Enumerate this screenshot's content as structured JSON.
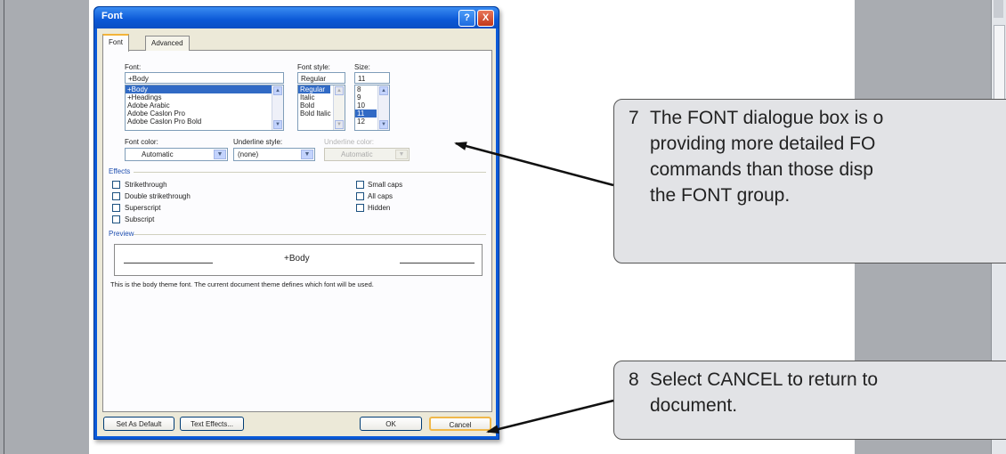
{
  "dialog": {
    "title": "Font",
    "help_icon": "?",
    "close_icon": "X",
    "tabs": [
      {
        "label": "Font"
      },
      {
        "label": "Advanced"
      }
    ],
    "font": {
      "label": "Font:",
      "value": "+Body",
      "items": [
        "+Body",
        "+Headings",
        "Adobe Arabic",
        "Adobe Caslon Pro",
        "Adobe Caslon Pro Bold"
      ],
      "selected": "+Body"
    },
    "font_style": {
      "label": "Font style:",
      "value": "Regular",
      "items": [
        "Regular",
        "Italic",
        "Bold",
        "Bold Italic"
      ],
      "selected": "Regular"
    },
    "size": {
      "label": "Size:",
      "value": "11",
      "items": [
        "8",
        "9",
        "10",
        "11",
        "12"
      ],
      "selected": "11"
    },
    "font_color": {
      "label": "Font color:",
      "value": "Automatic"
    },
    "underline_style": {
      "label": "Underline style:",
      "value": "(none)"
    },
    "underline_color": {
      "label": "Underline color:",
      "value": "Automatic"
    },
    "effects": {
      "title": "Effects",
      "left": [
        "Strikethrough",
        "Double strikethrough",
        "Superscript",
        "Subscript"
      ],
      "right": [
        "Small caps",
        "All caps",
        "Hidden"
      ]
    },
    "preview": {
      "title": "Preview",
      "text": "+Body",
      "description": "This is the body theme font. The current document theme defines which font will be used."
    },
    "buttons": {
      "set_default": "Set As Default",
      "text_effects": "Text Effects...",
      "ok": "OK",
      "cancel": "Cancel"
    }
  },
  "callouts": [
    {
      "number": "7",
      "first_line": "The FONT dialogue box is o",
      "lines": [
        "providing more detailed FO",
        "commands than those disp",
        "the FONT group."
      ]
    },
    {
      "number": "8",
      "first_line": "Select CANCEL to return to",
      "lines": [
        "document."
      ]
    }
  ],
  "colors": {
    "titlebar": "#0b58d6",
    "dialog_face": "#ece9d8",
    "selection": "#316ac5",
    "callout_bg": "#e2e3e6"
  }
}
